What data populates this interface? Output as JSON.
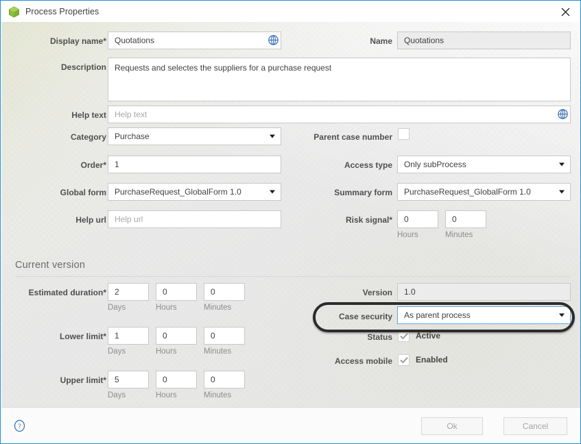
{
  "window": {
    "title": "Process Properties",
    "icon": "process-cube-icon",
    "close_label": "✕",
    "accent_color": "#1e8fd5"
  },
  "form": {
    "display_name": {
      "label": "Display name*",
      "value": "Quotations",
      "translate_icon": "globe-icon"
    },
    "name": {
      "label": "Name",
      "value": "Quotations"
    },
    "description": {
      "label": "Description",
      "value": "Requests and selectes the suppliers for a purchase request"
    },
    "help_text": {
      "label": "Help text",
      "value": "",
      "placeholder": "Help text",
      "translate_icon": "globe-icon"
    },
    "category": {
      "label": "Category",
      "value": "Purchase"
    },
    "parent_case_number": {
      "label": "Parent case number",
      "checked": false
    },
    "order": {
      "label": "Order*",
      "value": "1"
    },
    "access_type": {
      "label": "Access type",
      "value": "Only subProcess"
    },
    "global_form": {
      "label": "Global form",
      "value": "PurchaseRequest_GlobalForm 1.0"
    },
    "summary_form": {
      "label": "Summary form",
      "value": "PurchaseRequest_GlobalForm 1.0"
    },
    "help_url": {
      "label": "Help url",
      "value": "",
      "placeholder": "Help url"
    },
    "risk_signal": {
      "label": "Risk signal*",
      "hours": "0",
      "minutes": "0",
      "hours_caption": "Hours",
      "minutes_caption": "Minutes"
    }
  },
  "current_version": {
    "section_title": "Current version",
    "estimated_duration": {
      "label": "Estimated duration*",
      "days": "2",
      "hours": "0",
      "minutes": "0",
      "days_caption": "Days",
      "hours_caption": "Hours",
      "minutes_caption": "Minutes"
    },
    "lower_limit": {
      "label": "Lower limit*",
      "days": "1",
      "hours": "0",
      "minutes": "0",
      "days_caption": "Days",
      "hours_caption": "Hours",
      "minutes_caption": "Minutes"
    },
    "upper_limit": {
      "label": "Upper limit*",
      "days": "5",
      "hours": "0",
      "minutes": "0",
      "days_caption": "Days",
      "hours_caption": "Hours",
      "minutes_caption": "Minutes"
    },
    "version": {
      "label": "Version",
      "value": "1.0"
    },
    "case_security": {
      "label": "Case security",
      "value": "As parent process",
      "highlighted": true
    },
    "status": {
      "label": "Status",
      "checkbox_label": "Active",
      "checked": true
    },
    "access_mobile": {
      "label": "Access mobile",
      "checkbox_label": "Enabled",
      "checked": true
    }
  },
  "footer": {
    "help_icon": "question-mark-icon",
    "ok_label": "Ok",
    "cancel_label": "Cancel"
  }
}
